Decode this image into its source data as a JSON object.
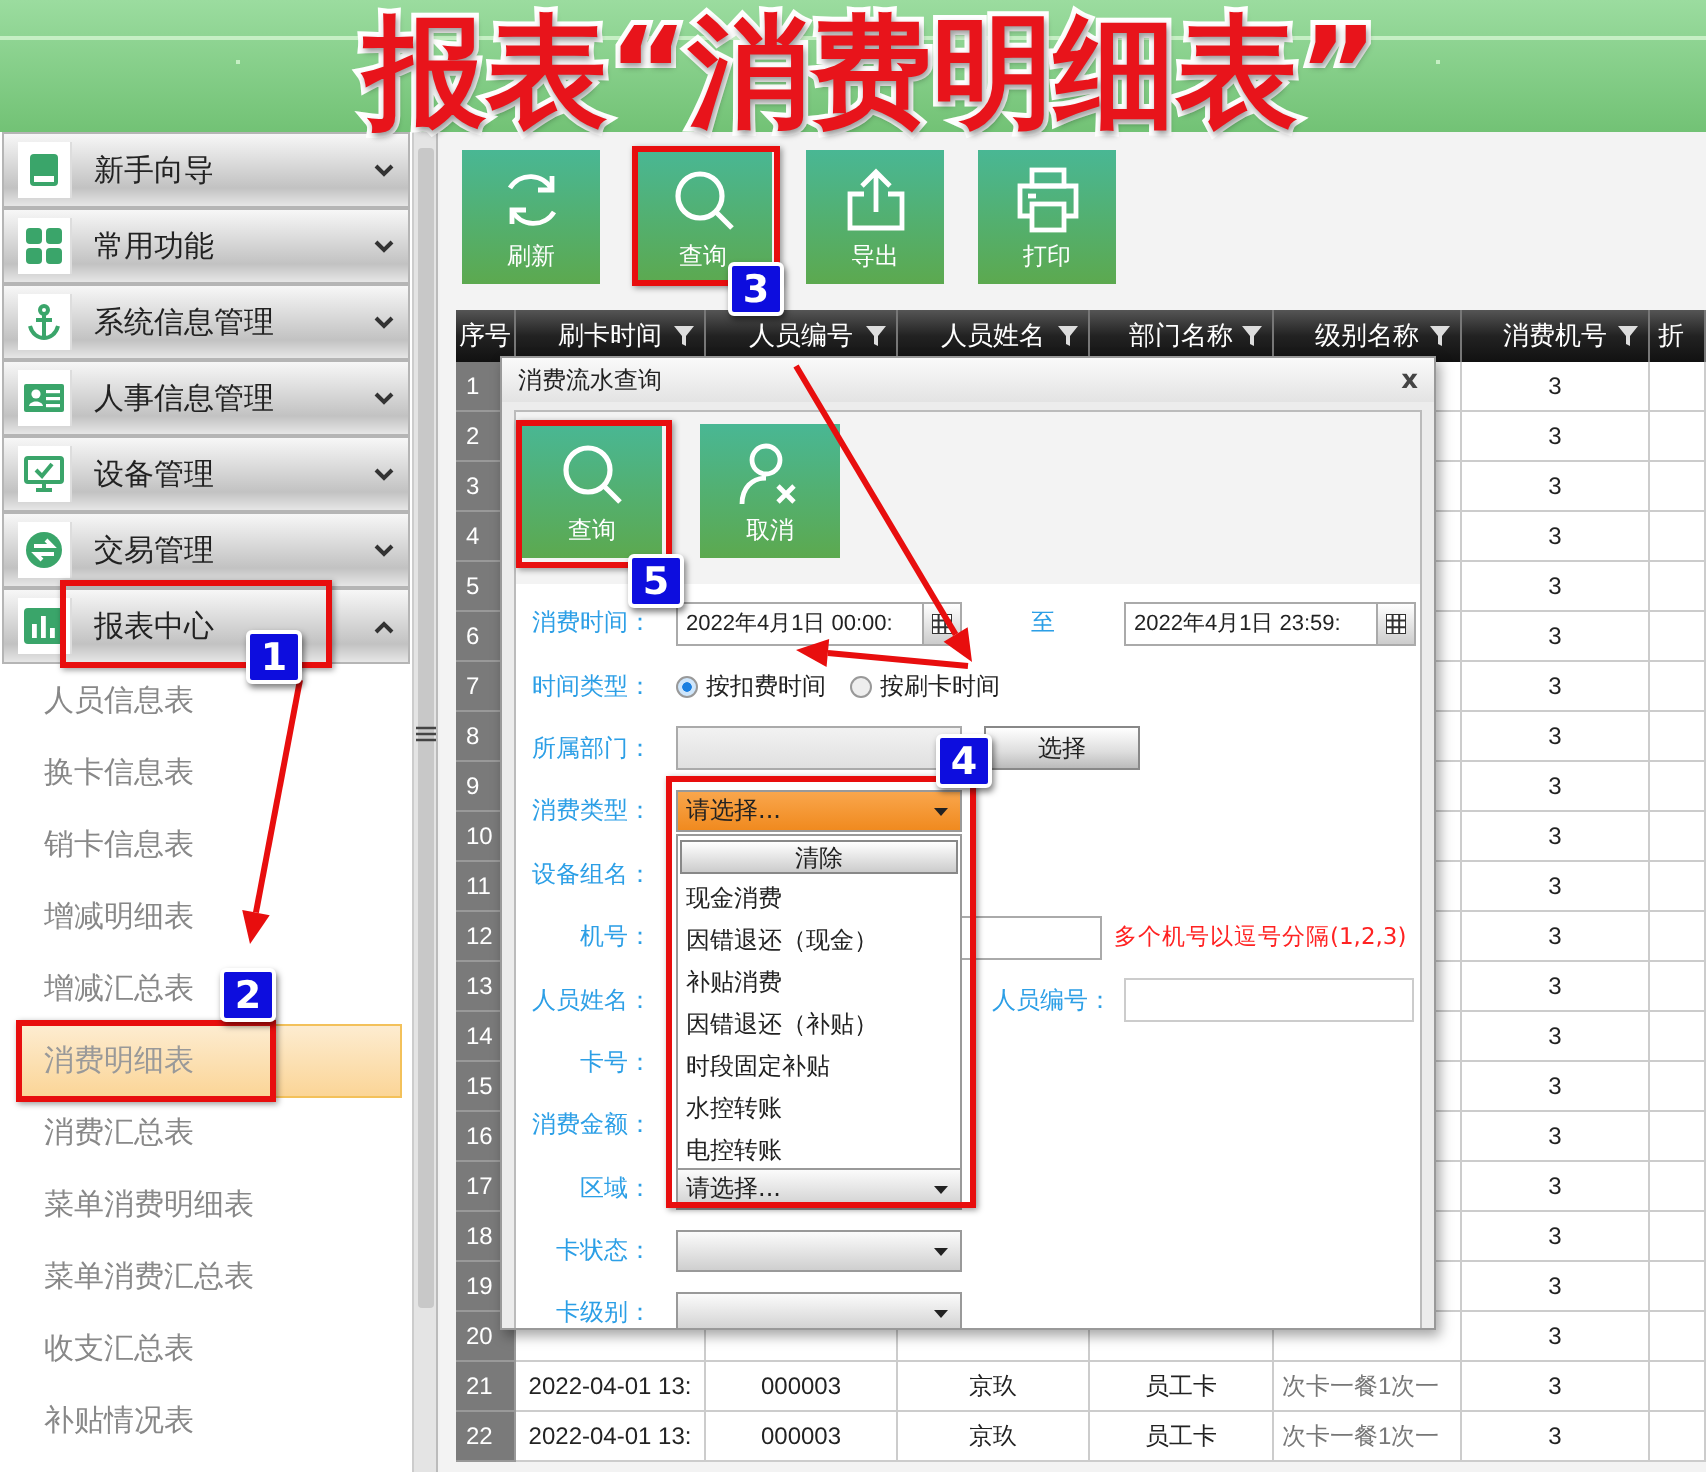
{
  "banner_title": "报表“消费明细表”",
  "sidebar": {
    "sections": [
      {
        "label": "新手向导",
        "expanded": false
      },
      {
        "label": "常用功能",
        "expanded": false
      },
      {
        "label": "系统信息管理",
        "expanded": false
      },
      {
        "label": "人事信息管理",
        "expanded": false
      },
      {
        "label": "设备管理",
        "expanded": false
      },
      {
        "label": "交易管理",
        "expanded": false
      },
      {
        "label": "报表中心",
        "expanded": true,
        "children": [
          {
            "label": "人员信息表",
            "selected": false
          },
          {
            "label": "换卡信息表",
            "selected": false
          },
          {
            "label": "销卡信息表",
            "selected": false
          },
          {
            "label": "增减明细表",
            "selected": false
          },
          {
            "label": "增减汇总表",
            "selected": false
          },
          {
            "label": "消费明细表",
            "selected": true
          },
          {
            "label": "消费汇总表",
            "selected": false
          },
          {
            "label": "菜单消费明细表",
            "selected": false
          },
          {
            "label": "菜单消费汇总表",
            "selected": false
          },
          {
            "label": "收支汇总表",
            "selected": false
          },
          {
            "label": "补贴情况表",
            "selected": false
          }
        ]
      }
    ]
  },
  "toolbar": [
    {
      "label": "刷新"
    },
    {
      "label": "查询"
    },
    {
      "label": "导出"
    },
    {
      "label": "打印"
    }
  ],
  "table": {
    "columns": [
      {
        "label": "序号",
        "filter": false
      },
      {
        "label": "刷卡时间",
        "filter": true
      },
      {
        "label": "人员编号",
        "filter": true
      },
      {
        "label": "人员姓名",
        "filter": true
      },
      {
        "label": "部门名称",
        "filter": true
      },
      {
        "label": "级别名称",
        "filter": true
      },
      {
        "label": "消费机号",
        "filter": true
      },
      {
        "label": "折",
        "filter": false
      }
    ],
    "rows": [
      {
        "no": "1",
        "machine": "3"
      },
      {
        "no": "2",
        "machine": "3"
      },
      {
        "no": "3",
        "machine": "3"
      },
      {
        "no": "4",
        "machine": "3"
      },
      {
        "no": "5",
        "machine": "3"
      },
      {
        "no": "6",
        "machine": "3"
      },
      {
        "no": "7",
        "machine": "3"
      },
      {
        "no": "8",
        "machine": "3"
      },
      {
        "no": "9",
        "machine": "3"
      },
      {
        "no": "10",
        "machine": "3"
      },
      {
        "no": "11",
        "machine": "3"
      },
      {
        "no": "12",
        "machine": "3"
      },
      {
        "no": "13",
        "machine": "3"
      },
      {
        "no": "14",
        "machine": "3"
      },
      {
        "no": "15",
        "machine": "3"
      },
      {
        "no": "16",
        "machine": "3"
      },
      {
        "no": "17",
        "machine": "3"
      },
      {
        "no": "18",
        "machine": "3"
      },
      {
        "no": "19",
        "machine": "3"
      },
      {
        "no": "20",
        "machine": "3"
      },
      {
        "no": "21",
        "time": "2022-04-01 13:",
        "person_id": "000003",
        "name": "京玖",
        "department": "员工卡",
        "level": "次卡一餐1次一",
        "machine": "3"
      },
      {
        "no": "22",
        "time": "2022-04-01 13:",
        "person_id": "000003",
        "name": "京玖",
        "department": "员工卡",
        "level": "次卡一餐1次一",
        "machine": "3"
      }
    ]
  },
  "dialog": {
    "title": "消费流水查询",
    "close": "x",
    "buttons": [
      {
        "label": "查询"
      },
      {
        "label": "取消"
      }
    ],
    "fields": [
      {
        "kind": "date-range",
        "label": "消费时间：",
        "from": "2022年4月1日 00:00:",
        "to_label": "至",
        "to": "2022年4月1日 23:59:"
      },
      {
        "kind": "radio",
        "label": "时间类型：",
        "options": [
          {
            "label": "按扣费时间",
            "selected": true
          },
          {
            "label": "按刷卡时间",
            "selected": false
          }
        ]
      },
      {
        "kind": "picker",
        "label": "所属部门：",
        "button": "选择"
      },
      {
        "kind": "dropdown",
        "label": "消费类型：",
        "value": "请选择...",
        "open": true,
        "clear": "清除",
        "options": [
          "现金消费",
          "因错退还（现金）",
          "补贴消费",
          "因错退还（补贴）",
          "时段固定补贴",
          "水控转账",
          "电控转账"
        ]
      },
      {
        "kind": "label",
        "label": "设备组名："
      },
      {
        "kind": "text",
        "label": "机号：",
        "hint": "多个机号以逗号分隔(1,2,3)"
      },
      {
        "kind": "pair",
        "label": "人员姓名：",
        "label2": "人员编号："
      },
      {
        "kind": "label",
        "label": "卡号："
      },
      {
        "kind": "label",
        "label": "消费金额："
      },
      {
        "kind": "dropdown",
        "label": "区域：",
        "value": "请选择...",
        "open": false
      },
      {
        "kind": "dropdown",
        "label": "卡状态：",
        "open": false
      },
      {
        "kind": "dropdown",
        "label": "卡级别：",
        "open": false
      }
    ]
  },
  "annotations": [
    "1",
    "2",
    "3",
    "4",
    "5"
  ]
}
